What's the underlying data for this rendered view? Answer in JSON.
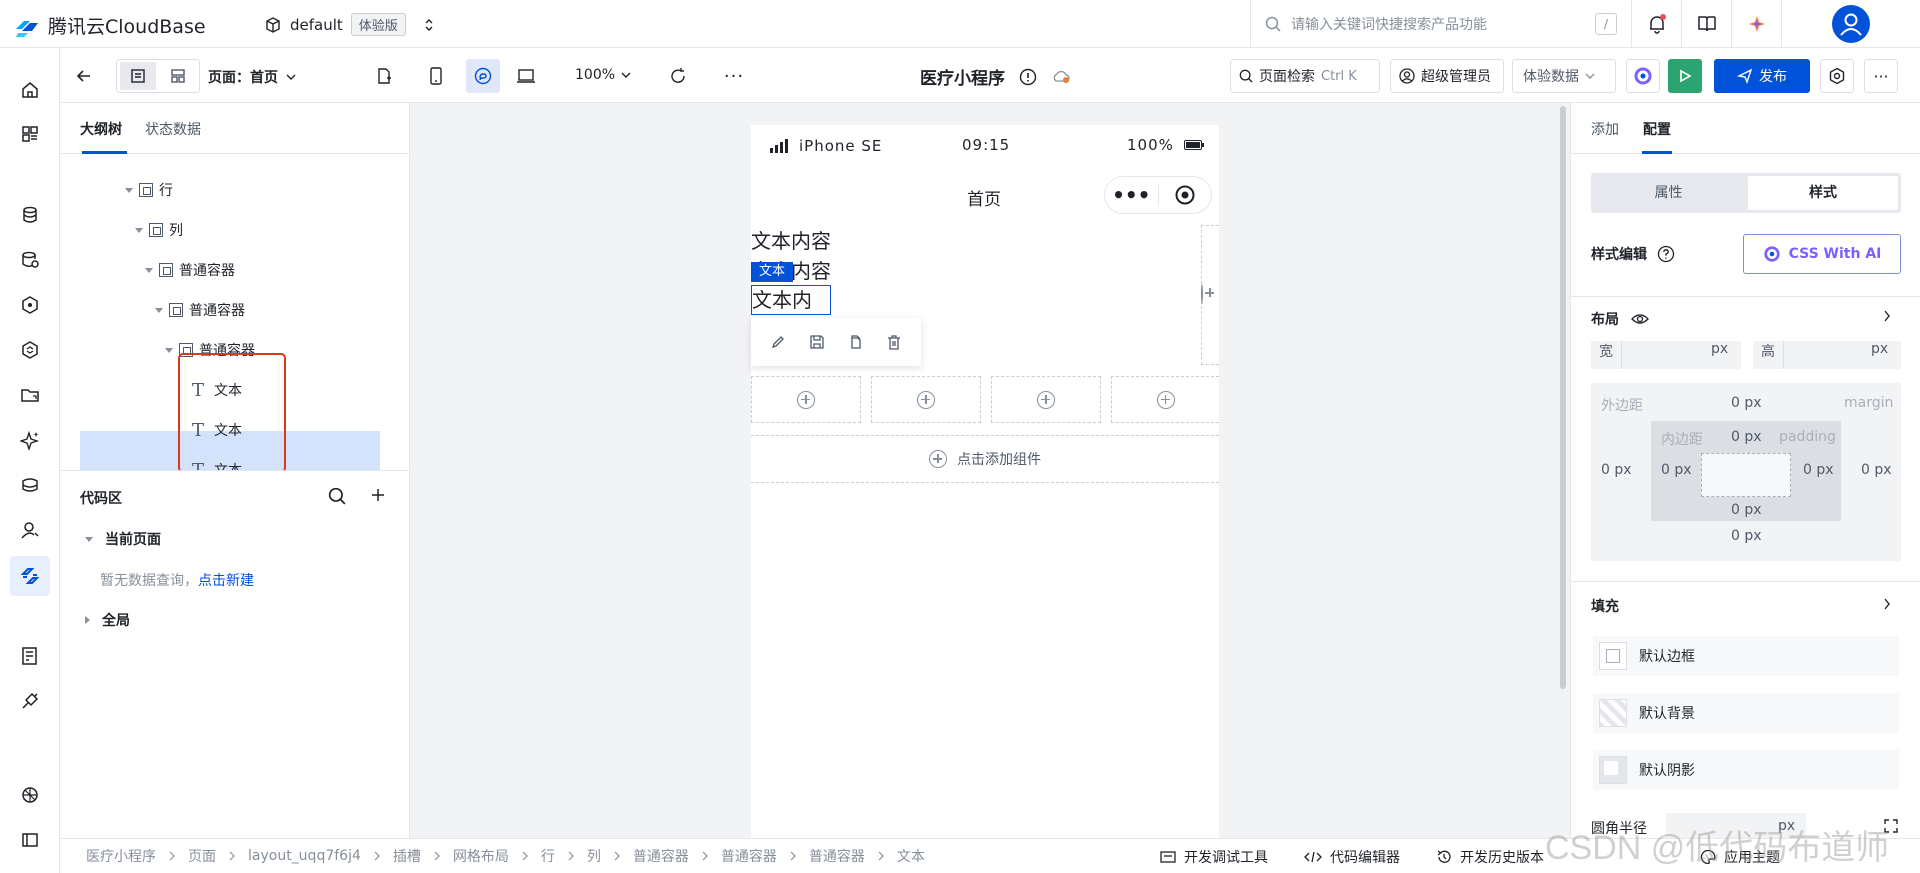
{
  "topbar": {
    "brand": "腾讯云CloudBase",
    "env_name": "default",
    "env_badge": "体验版",
    "search_placeholder": "请输入关键词快捷搜索产品功能",
    "search_key": "/"
  },
  "toolbar": {
    "page_label": "页面：首页",
    "zoom": "100%",
    "app_title": "医疗小程序",
    "page_search": "页面检索",
    "page_search_kbd": "Ctrl K",
    "admin": "超级管理员",
    "data_mode": "体验数据",
    "publish": "发布"
  },
  "outline": {
    "tabs": [
      "大纲树",
      "状态数据"
    ],
    "tree": [
      {
        "label": "行"
      },
      {
        "label": "列"
      },
      {
        "label": "普通容器"
      },
      {
        "label": "普通容器"
      },
      {
        "label": "普通容器"
      },
      {
        "label": "文本"
      },
      {
        "label": "文本"
      },
      {
        "label": "文本"
      }
    ]
  },
  "code": {
    "title": "代码区",
    "current_page": "当前页面",
    "empty_text": "暂无数据查询，",
    "create_link": "点击新建",
    "global": "全局"
  },
  "phone": {
    "carrier": "iPhone SE",
    "time": "09:15",
    "battery": "100%",
    "nav_title": "首页",
    "texts": [
      "文本内容",
      "文本内容",
      "文本内容"
    ],
    "selected_tag": "文本",
    "add_component": "点击添加组件"
  },
  "right": {
    "tabs": [
      "添加",
      "配置"
    ],
    "seg": [
      "属性",
      "样式"
    ],
    "style_edit": "样式编辑",
    "css_ai": "CSS With AI",
    "layout": "布局",
    "width_label": "宽",
    "height_label": "高",
    "px": "px",
    "margin_label": "外边距",
    "margin_en": "margin",
    "padding_label": "内边距",
    "padding_en": "padding",
    "zero_px": "0 px",
    "fill": "填充",
    "fill_items": [
      "默认边框",
      "默认背景",
      "默认阴影"
    ],
    "radius": "圆角半径"
  },
  "footer": {
    "crumbs": [
      "医疗小程序",
      "页面",
      "layout_uqq7f6j4",
      "插槽",
      "网格布局",
      "行",
      "列",
      "普通容器",
      "普通容器",
      "普通容器",
      "文本"
    ],
    "debug": "开发调试工具",
    "code_editor": "代码编辑器",
    "history": "开发历史版本",
    "apply_theme": "应用主题",
    "watermark": "CSDN @低代码布道师"
  }
}
